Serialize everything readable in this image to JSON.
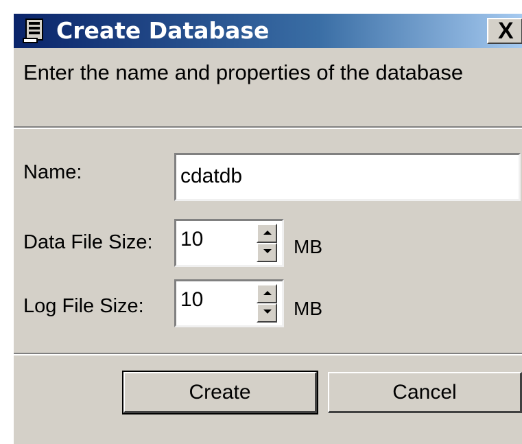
{
  "dialog": {
    "title": "Create Database",
    "close_label": "X",
    "description": "Enter the name and properties of the database"
  },
  "form": {
    "name_label": "Name:",
    "name_value": "cdatdb",
    "data_size_label": "Data File Size:",
    "data_size_value": "10",
    "data_size_unit": "MB",
    "log_size_label": "Log File Size:",
    "log_size_value": "10",
    "log_size_unit": "MB"
  },
  "buttons": {
    "create_label": "Create",
    "cancel_label": "Cancel"
  },
  "colors": {
    "title_gradient_start": "#0a246a",
    "title_gradient_end": "#a6caf0",
    "face": "#d4d0c8"
  }
}
